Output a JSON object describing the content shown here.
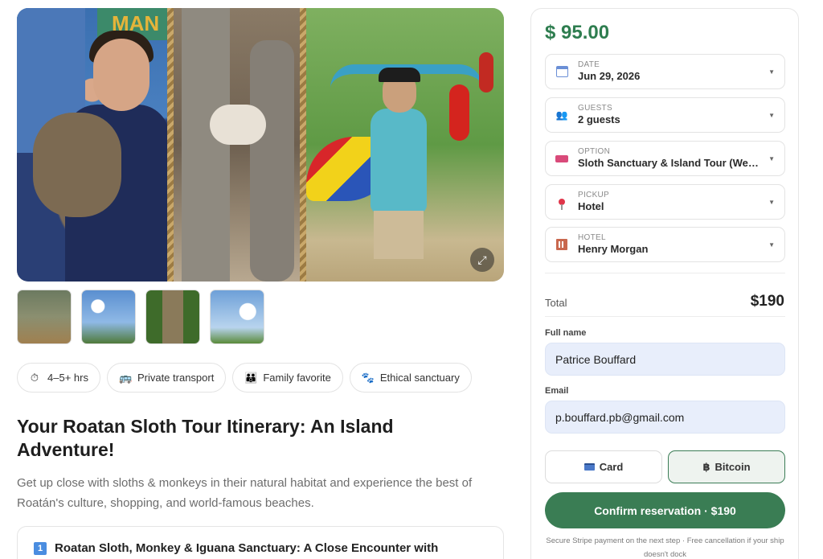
{
  "gallery": {
    "sign_text": "MAN",
    "expand_icon": "expand-icon"
  },
  "thumbnails": [
    "thumb-1",
    "thumb-2",
    "thumb-3",
    "thumb-4"
  ],
  "chips": [
    {
      "icon": "stopwatch-icon",
      "glyph": "⏱",
      "label": "4–5+ hrs"
    },
    {
      "icon": "bus-icon",
      "glyph": "🚌",
      "label": "Private transport"
    },
    {
      "icon": "family-icon",
      "glyph": "👪",
      "label": "Family favorite"
    },
    {
      "icon": "paw-icon",
      "glyph": "🐾",
      "label": "Ethical sanctuary"
    }
  ],
  "title": "Your Roatan Sloth Tour Itinerary: An Island Adventure!",
  "subtitle": "Get up close with sloths & monkeys in their natural habitat and experience the best of Roatán's culture, shopping, and world-famous beaches.",
  "itinerary": {
    "number": "1",
    "title": "Roatan Sloth, Monkey & Iguana Sanctuary: A Close Encounter with"
  },
  "booking": {
    "price": "$ 95.00",
    "fields": {
      "date": {
        "label": "DATE",
        "value": "Jun 29, 2026"
      },
      "guests": {
        "label": "GUESTS",
        "value": "2 guests"
      },
      "option": {
        "label": "OPTION",
        "value": "Sloth Sanctuary & Island Tour (West End)"
      },
      "pickup": {
        "label": "PICKUP",
        "value": "Hotel"
      },
      "hotel": {
        "label": "HOTEL",
        "value": "Henry Morgan"
      }
    },
    "total_label": "Total",
    "total_value": "$190",
    "full_name_label": "Full name",
    "full_name_value": "Patrice Bouffard",
    "email_label": "Email",
    "email_value": "p.bouffard.pb@gmail.com",
    "pay_card_label": "Card",
    "pay_bitcoin_label": "Bitcoin",
    "bitcoin_glyph": "฿",
    "confirm_label": "Confirm reservation · $190",
    "secure_note": "Secure Stripe payment on the next step · Free cancellation if your ship doesn't dock"
  },
  "colors": {
    "accent_green": "#3a7d54",
    "price_green": "#2e7d4f",
    "input_bg": "#e8eefb"
  }
}
